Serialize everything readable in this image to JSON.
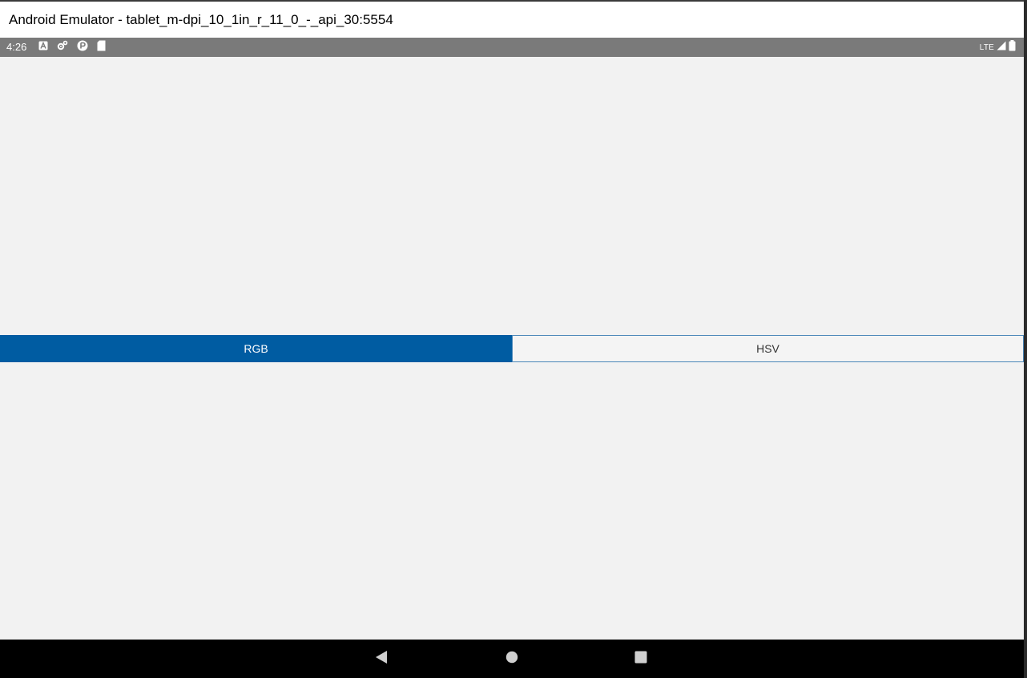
{
  "window": {
    "title": "Android Emulator - tablet_m-dpi_10_1in_r_11_0_-_api_30:5554"
  },
  "status_bar": {
    "time": "4:26",
    "network": "LTE",
    "left_icons": [
      "notification-a-icon",
      "settings-gear-icon",
      "play-protect-icon",
      "sd-card-icon"
    ],
    "right_icons": [
      "signal-icon",
      "battery-icon"
    ]
  },
  "segmented_control": {
    "segments": [
      {
        "label": "RGB",
        "selected": true
      },
      {
        "label": "HSV",
        "selected": false
      }
    ],
    "active_color": "#005ca2",
    "inactive_border_color": "#4a86b8"
  },
  "navigation_bar": {
    "buttons": [
      "back-icon",
      "home-icon",
      "recents-icon"
    ]
  }
}
